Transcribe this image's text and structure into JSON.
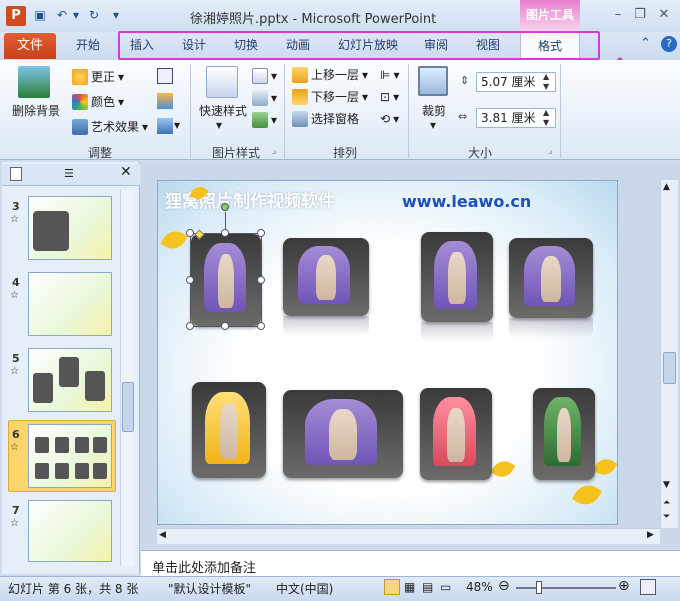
{
  "window": {
    "title": "徐湘婷照片.pptx - Microsoft PowerPoint",
    "context_tool": "图片工具"
  },
  "tabs": [
    "文件",
    "开始",
    "插入",
    "设计",
    "切换",
    "动画",
    "幻灯片放映",
    "审阅",
    "视图",
    "格式"
  ],
  "ribbon": {
    "adjust": {
      "remove_bg": "删除背景",
      "correct": "更正",
      "color": "颜色",
      "art": "艺术效果",
      "label": "调整"
    },
    "picstyle": {
      "quick": "快速样式",
      "label": "图片样式"
    },
    "arrange": {
      "forward": "上移一层",
      "backward": "下移一层",
      "pane": "选择窗格",
      "label": "排列"
    },
    "size": {
      "crop": "裁剪",
      "height": "5.07 厘米",
      "width": "3.81 厘米",
      "label": "大小"
    }
  },
  "thumbnails": [
    {
      "num": "3",
      "star": "☆"
    },
    {
      "num": "4",
      "star": "☆"
    },
    {
      "num": "5",
      "star": "☆"
    },
    {
      "num": "6",
      "star": "☆"
    },
    {
      "num": "7",
      "star": "☆"
    }
  ],
  "slide": {
    "title": "狸窝照片制作视频软件",
    "url": "www.leawo.cn"
  },
  "notes": "单击此处添加备注",
  "status": {
    "slide_info": "幻灯片 第 6 张，共 8 张",
    "theme": "\"默认设计模板\"",
    "language": "中文(中国)",
    "zoom": "48%"
  },
  "colors": {
    "file_tab": "#d04b1d",
    "accent_highlight": "#d53bd6",
    "context_tab": "#e87fcf"
  }
}
